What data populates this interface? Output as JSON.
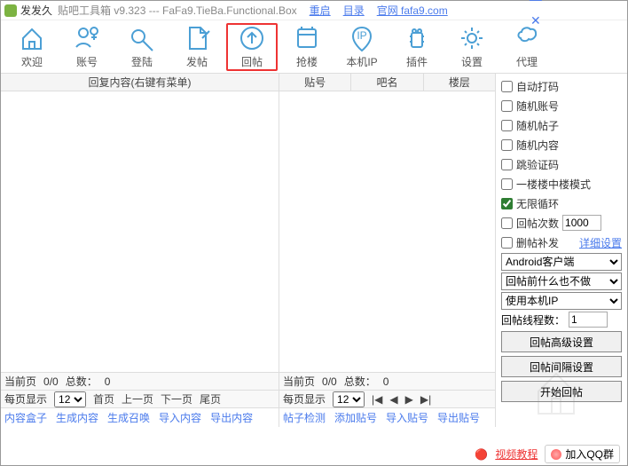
{
  "title": {
    "app": "发发久",
    "sub": "贴吧工具箱 v9.323 --- FaFa9.TieBa.Functional.Box",
    "restart": "重启",
    "catalog": "目录",
    "site": "官网 fafa9.com"
  },
  "toolbar": [
    {
      "k": "welcome",
      "label": "欢迎"
    },
    {
      "k": "account",
      "label": "账号"
    },
    {
      "k": "login",
      "label": "登陆"
    },
    {
      "k": "post",
      "label": "发帖"
    },
    {
      "k": "reply",
      "label": "回帖",
      "sel": true
    },
    {
      "k": "grab",
      "label": "抢楼"
    },
    {
      "k": "ip",
      "label": "本机IP"
    },
    {
      "k": "plugin",
      "label": "插件"
    },
    {
      "k": "settings",
      "label": "设置"
    },
    {
      "k": "proxy",
      "label": "代理"
    }
  ],
  "left": {
    "head": "回复内容(右键有菜单)",
    "pager": {
      "cur": "当前页",
      "cv": "0/0",
      "total": "总数：",
      "tv": "0",
      "per": "每页显示",
      "pv": "12",
      "first": "首页",
      "prev": "上一页",
      "next": "下一页",
      "last": "尾页"
    },
    "acts": [
      "内容盒子",
      "生成内容",
      "生成召唤",
      "导入内容",
      "导出内容"
    ]
  },
  "mid": {
    "heads": [
      "贴号",
      "吧名",
      "楼层"
    ],
    "pager": {
      "cur": "当前页",
      "cv": "0/0",
      "total": "总数：",
      "tv": "0",
      "per": "每页显示",
      "pv": "12"
    },
    "acts": [
      "帖子检测",
      "添加贴号",
      "导入贴号",
      "导出贴号"
    ]
  },
  "right": {
    "cb": {
      "autocode": "自动打码",
      "randacct": "随机账号",
      "randpost": "随机帖子",
      "randcontent": "随机内容",
      "skipcode": "跳验证码",
      "floormode": "一楼楼中楼模式",
      "loop": "无限循环",
      "replycount": "回帖次数",
      "delrepost": "删帖补发"
    },
    "countval": "1000",
    "detail": "详细设置",
    "sel1": "Android客户端",
    "sel2": "回帖前什么也不做",
    "sel3": "使用本机IP",
    "threads_lbl": "回帖线程数：",
    "threads_v": "1",
    "btn1": "回帖高级设置",
    "btn2": "回帖间隔设置",
    "btn3": "开始回帖"
  },
  "bottom": {
    "video": "视频教程",
    "qq": "加入QQ群"
  }
}
